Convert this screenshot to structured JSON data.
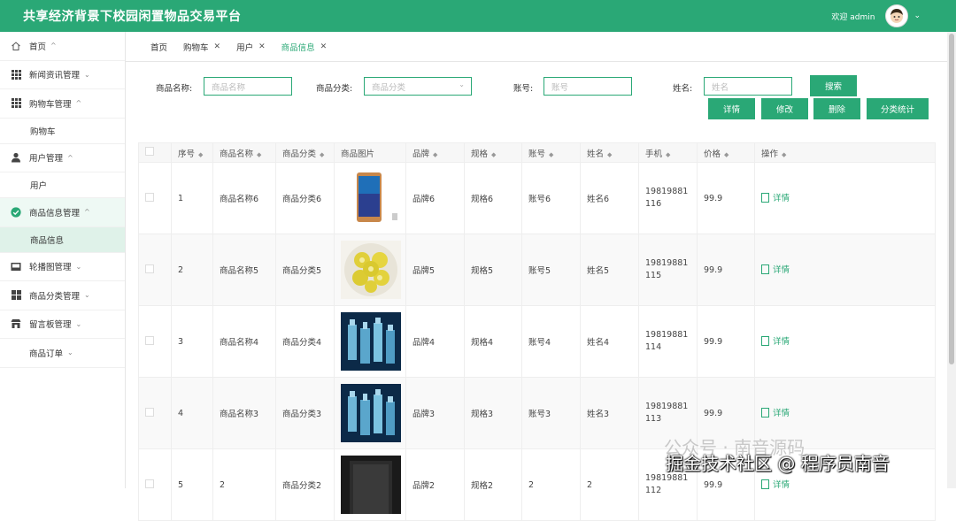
{
  "header": {
    "title": "共享经济背景下校园闲置物品交易平台",
    "welcome": "欢迎 admin",
    "accent": "#2aa876"
  },
  "sidebar": {
    "items": [
      {
        "label": "首页",
        "icon": "home-icon"
      },
      {
        "label": "新闻资讯管理",
        "icon": "grid-icon"
      },
      {
        "label": "购物车管理",
        "icon": "grid-icon"
      },
      {
        "label": "购物车",
        "sub": true
      },
      {
        "label": "用户管理",
        "icon": "user-icon"
      },
      {
        "label": "用户",
        "sub": true
      },
      {
        "label": "商品信息管理",
        "icon": "check-circle-icon",
        "active": true
      },
      {
        "label": "商品信息",
        "sub": true,
        "active": true
      },
      {
        "label": "轮播图管理",
        "icon": "image-icon"
      },
      {
        "label": "商品分类管理",
        "icon": "grid-icon"
      },
      {
        "label": "留言板管理",
        "icon": "shop-icon"
      },
      {
        "label": "商品订单",
        "icon": ""
      }
    ]
  },
  "tabs": [
    {
      "label": "首页",
      "closable": false
    },
    {
      "label": "购物车",
      "closable": true
    },
    {
      "label": "用户",
      "closable": true
    },
    {
      "label": "商品信息",
      "closable": true,
      "active": true
    }
  ],
  "search": {
    "name_label": "商品名称:",
    "name_placeholder": "商品名称",
    "category_label": "商品分类:",
    "category_placeholder": "商品分类",
    "account_label": "账号:",
    "account_placeholder": "账号",
    "username_label": "姓名:",
    "username_placeholder": "姓名",
    "search_button": "搜索"
  },
  "actions": {
    "detail": "详情",
    "edit": "修改",
    "delete": "删除",
    "stats": "分类统计"
  },
  "table": {
    "columns": [
      "序号",
      "商品名称",
      "商品分类",
      "商品图片",
      "品牌",
      "规格",
      "账号",
      "姓名",
      "手机",
      "价格",
      "操作"
    ],
    "action_label": "详情",
    "rows": [
      {
        "idx": "1",
        "name": "商品名称6",
        "category": "商品分类6",
        "image": "phone",
        "brand": "品牌6",
        "spec": "规格6",
        "account": "账号6",
        "username": "姓名6",
        "phone": "19819881116",
        "price": "99.9"
      },
      {
        "idx": "2",
        "name": "商品名称5",
        "category": "商品分类5",
        "image": "lemon",
        "brand": "品牌5",
        "spec": "规格5",
        "account": "账号5",
        "username": "姓名5",
        "phone": "19819881115",
        "price": "99.9"
      },
      {
        "idx": "3",
        "name": "商品名称4",
        "category": "商品分类4",
        "image": "bottles",
        "brand": "品牌4",
        "spec": "规格4",
        "account": "账号4",
        "username": "姓名4",
        "phone": "19819881114",
        "price": "99.9"
      },
      {
        "idx": "4",
        "name": "商品名称3",
        "category": "商品分类3",
        "image": "bottles",
        "brand": "品牌3",
        "spec": "规格3",
        "account": "账号3",
        "username": "姓名3",
        "phone": "19819881113",
        "price": "99.9"
      },
      {
        "idx": "5",
        "name": "2",
        "category": "商品分类2",
        "image": "dark",
        "brand": "品牌2",
        "spec": "规格2",
        "account": "2",
        "username": "2",
        "phone": "19819881112",
        "price": "99.9"
      }
    ]
  },
  "watermark": {
    "line1": "公众号 · 南音源码",
    "line2": "掘金技术社区 @ 程序员南音"
  }
}
